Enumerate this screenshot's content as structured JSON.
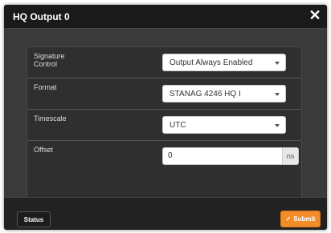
{
  "dialog": {
    "title": "HQ Output 0",
    "close_symbol": "✕"
  },
  "form": {
    "signature_control": {
      "label": "Signature\nControl",
      "value": "Output Always Enabled"
    },
    "format": {
      "label": "Format",
      "value": "STANAG 4246 HQ I"
    },
    "timescale": {
      "label": "Timescale",
      "value": "UTC"
    },
    "offset": {
      "label": "Offset",
      "value": "0",
      "unit": "ns"
    }
  },
  "footer": {
    "status_label": "Status",
    "submit_label": "Submit",
    "submit_icon": "✓"
  },
  "colors": {
    "accent": "#f28c28",
    "title_bg": "#1a1a1a",
    "body_bg": "#3a3a3a"
  }
}
